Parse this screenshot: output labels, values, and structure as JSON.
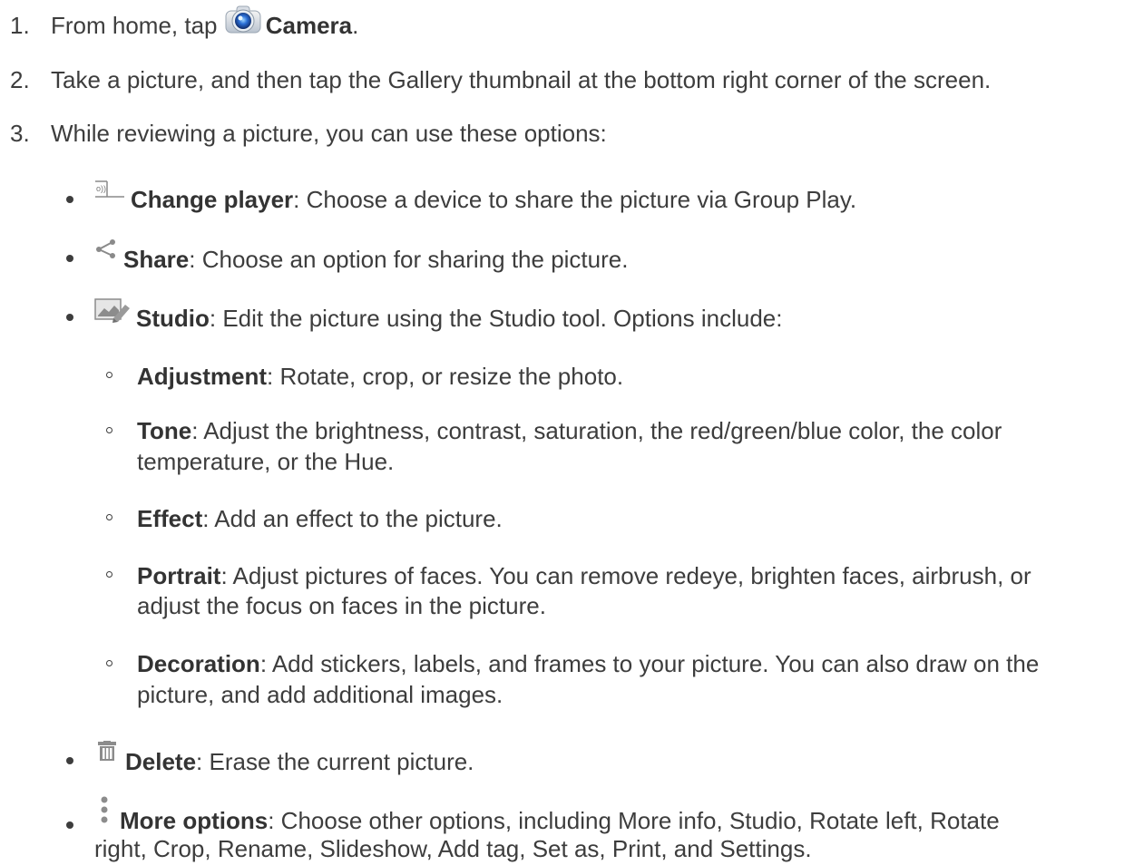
{
  "steps": [
    {
      "num": "1.",
      "pre": "From home, tap ",
      "bold": "Camera",
      "post": "."
    },
    {
      "num": "2.",
      "text": "Take a picture, and then tap the Gallery thumbnail at the bottom right corner of the screen."
    },
    {
      "num": "3.",
      "text": "While reviewing a picture, you can use these options:"
    }
  ],
  "options": [
    {
      "icon": "change-player-icon",
      "label": "Change player",
      "desc": ": Choose a device to share the picture via Group Play."
    },
    {
      "icon": "share-icon",
      "label": "Share",
      "desc": ": Choose an option for sharing the picture."
    },
    {
      "icon": "studio-icon",
      "label": "Studio",
      "desc": ": Edit the picture using the Studio tool. Options include:"
    },
    {
      "icon": "trash-icon",
      "label": "Delete",
      "desc": ": Erase the current picture."
    },
    {
      "icon": "more-options-icon",
      "label": "More options",
      "desc": ": Choose other options, including More info, Studio, Rotate left, Rotate",
      "desc_line2": "right, Crop, Rename, Slideshow, Add tag, Set as, Print, and Settings."
    }
  ],
  "studio_options": [
    {
      "label": "Adjustment",
      "desc": ": Rotate, crop, or resize the photo."
    },
    {
      "label": "Tone",
      "desc": ": Adjust the brightness, contrast, saturation, the red/green/blue color, the color",
      "desc_line2": "temperature, or the Hue."
    },
    {
      "label": "Effect",
      "desc": ": Add an effect to the picture."
    },
    {
      "label": "Portrait",
      "desc": ": Adjust pictures of faces. You can remove redeye, brighten faces, airbrush, or",
      "desc_line2": "adjust the focus on faces in the picture."
    },
    {
      "label": "Decoration",
      "desc": ": Add stickers, labels, and frames to your picture. You can also draw on the",
      "desc_line2": "picture, and add additional images."
    }
  ]
}
